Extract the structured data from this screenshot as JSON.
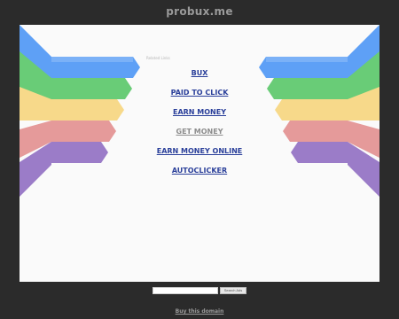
{
  "header": {
    "domain": "probux.me"
  },
  "main": {
    "related_label": "Related Links",
    "links": [
      {
        "label": "BUX",
        "state": "normal"
      },
      {
        "label": "PAID TO CLICK",
        "state": "normal"
      },
      {
        "label": "EARN MONEY",
        "state": "normal"
      },
      {
        "label": "GET MONEY",
        "state": "visited"
      },
      {
        "label": "EARN MONEY ONLINE",
        "state": "normal"
      },
      {
        "label": "AUTOCLICKER",
        "state": "normal"
      }
    ],
    "stripe_colors": [
      "#5ea0f6",
      "#69cc77",
      "#f7d98a",
      "#e59a9a",
      "#9b7cc8"
    ]
  },
  "search": {
    "value": "",
    "button_label": "Search Ads"
  },
  "footer": {
    "buy_label": "Buy this domain"
  },
  "colors": {
    "background": "#2b2b2b",
    "panel": "#fafafa",
    "link": "#2a3f9a",
    "visited_link": "#8c8c8c"
  }
}
